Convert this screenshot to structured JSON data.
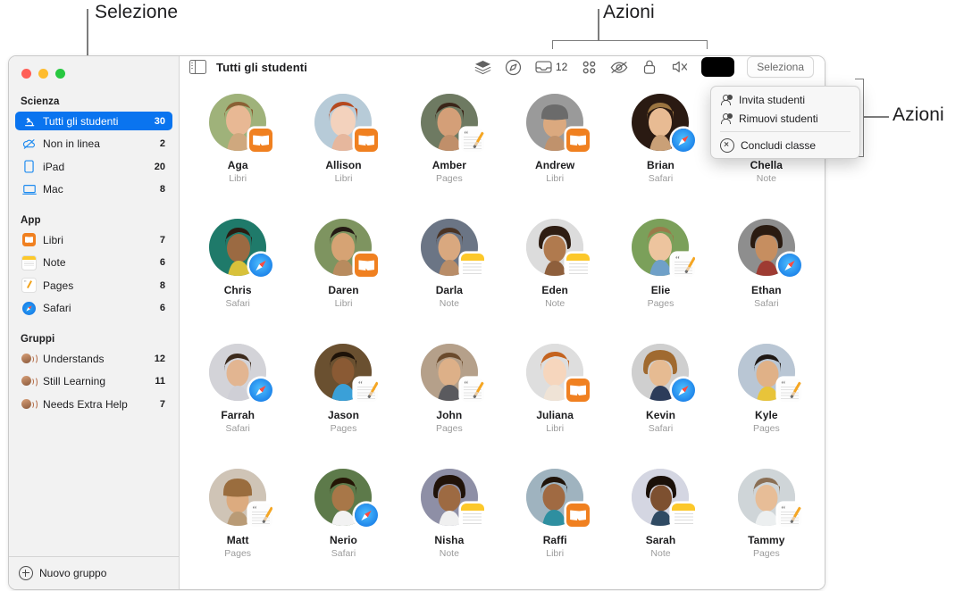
{
  "annotations": [
    {
      "id": "selezione",
      "label": "Selezione"
    },
    {
      "id": "azioni-top",
      "label": "Azioni"
    },
    {
      "id": "azioni-right",
      "label": "Azioni"
    }
  ],
  "window": {
    "traffic_lights": [
      "close",
      "minimize",
      "zoom"
    ]
  },
  "sidebar": {
    "sections": [
      {
        "title": "Scienza",
        "items": [
          {
            "label": "Tutti gli studenti",
            "count": "30",
            "icon": "microscope-icon",
            "selected": true
          },
          {
            "label": "Non in linea",
            "count": "2",
            "icon": "cloud-slash-icon",
            "selected": false
          },
          {
            "label": "iPad",
            "count": "20",
            "icon": "ipad-icon",
            "selected": false
          },
          {
            "label": "Mac",
            "count": "8",
            "icon": "mac-icon",
            "selected": false
          }
        ]
      },
      {
        "title": "App",
        "items": [
          {
            "label": "Libri",
            "count": "7",
            "icon": "books-app-icon",
            "selected": false
          },
          {
            "label": "Note",
            "count": "6",
            "icon": "notes-app-icon",
            "selected": false
          },
          {
            "label": "Pages",
            "count": "8",
            "icon": "pages-app-icon",
            "selected": false
          },
          {
            "label": "Safari",
            "count": "6",
            "icon": "safari-app-icon",
            "selected": false
          }
        ]
      },
      {
        "title": "Gruppi",
        "items": [
          {
            "label": "Understands",
            "count": "12",
            "icon": "group-icon",
            "selected": false
          },
          {
            "label": "Still Learning",
            "count": "11",
            "icon": "group-icon",
            "selected": false
          },
          {
            "label": "Needs Extra Help",
            "count": "7",
            "icon": "group-icon",
            "selected": false
          }
        ]
      }
    ],
    "footer": {
      "label": "Nuovo gruppo",
      "icon": "plus-circle-icon"
    }
  },
  "toolbar": {
    "sidebar_toggle_icon": "sidebar-toggle-icon",
    "title": "Tutti gli studenti",
    "actions": [
      {
        "icon": "layers-icon",
        "label": ""
      },
      {
        "icon": "navigate-icon",
        "label": ""
      },
      {
        "icon": "inbox-icon",
        "label": "12"
      },
      {
        "icon": "apps-grid-icon",
        "label": ""
      },
      {
        "icon": "eye-slash-icon",
        "label": ""
      },
      {
        "icon": "lock-icon",
        "label": ""
      },
      {
        "icon": "mute-icon",
        "label": ""
      }
    ],
    "active_button": {
      "icon": "screen-button-icon",
      "color": "#000000"
    },
    "select_button": {
      "label": "Seleziona"
    }
  },
  "menu": {
    "items": [
      {
        "label": "Invita studenti",
        "icon": "person-add-icon",
        "divider_after": false
      },
      {
        "label": "Rimuovi studenti",
        "icon": "person-remove-icon",
        "divider_after": true
      },
      {
        "label": "Concludi classe",
        "icon": "x-circle-icon",
        "divider_after": false
      }
    ]
  },
  "students": [
    {
      "name": "Aga",
      "app": "Libri",
      "badge": "libri",
      "skin": "#e8b894",
      "hair": "#8a6034",
      "bg": "#9fb27a"
    },
    {
      "name": "Allison",
      "app": "Libri",
      "badge": "libri",
      "skin": "#f3d2bd",
      "hair": "#b5491f",
      "bg": "#b7cbd8"
    },
    {
      "name": "Amber",
      "app": "Pages",
      "badge": "pages",
      "skin": "#d49f78",
      "hair": "#3a2418",
      "bg": "#6e7a62"
    },
    {
      "name": "Andrew",
      "app": "Libri",
      "badge": "libri",
      "skin": "#dba97f",
      "hair": "#2b2b2b",
      "bg": "#9a9a9a"
    },
    {
      "name": "Brian",
      "app": "Safari",
      "badge": "safari",
      "skin": "#e8bb93",
      "hair": "#9c7540",
      "bg": "#2a1a12"
    },
    {
      "name": "Chella",
      "app": "Note",
      "badge": "note",
      "skin": "#c98f64",
      "hair": "#3a2216",
      "bg": "#c0c0c0"
    },
    {
      "name": "Chris",
      "app": "Safari",
      "badge": "safari",
      "skin": "#9b6a42",
      "hair": "#2b1c12",
      "bg": "#1f7a6a"
    },
    {
      "name": "Daren",
      "app": "Libri",
      "badge": "libri",
      "skin": "#d6a374",
      "hair": "#241a14",
      "bg": "#7e9460"
    },
    {
      "name": "Darla",
      "app": "Note",
      "badge": "note",
      "skin": "#d9a87f",
      "hair": "#4a3324",
      "bg": "#6b7585"
    },
    {
      "name": "Eden",
      "app": "Note",
      "badge": "note",
      "skin": "#b07a4e",
      "hair": "#2e1d12",
      "bg": "#dcdcdc"
    },
    {
      "name": "Elie",
      "app": "Pages",
      "badge": "pages",
      "skin": "#edc49e",
      "hair": "#9b7a4a",
      "bg": "#7ba05a"
    },
    {
      "name": "Ethan",
      "app": "Safari",
      "badge": "safari",
      "skin": "#c68e60",
      "hair": "#2a1b11",
      "bg": "#8e8e8e"
    },
    {
      "name": "Farrah",
      "app": "Safari",
      "badge": "safari",
      "skin": "#e2b591",
      "hair": "#3c2a1c",
      "bg": "#d3d3d8"
    },
    {
      "name": "Jason",
      "app": "Pages",
      "badge": "pages",
      "skin": "#8a5a34",
      "hair": "#1d1208",
      "bg": "#6a5030"
    },
    {
      "name": "John",
      "app": "Pages",
      "badge": "pages",
      "skin": "#ddb088",
      "hair": "#6a4a2c",
      "bg": "#b5a08a"
    },
    {
      "name": "Juliana",
      "app": "Libri",
      "badge": "libri",
      "skin": "#f6d6bd",
      "hair": "#c4631f",
      "bg": "#dedede"
    },
    {
      "name": "Kevin",
      "app": "Safari",
      "badge": "safari",
      "skin": "#e6bb92",
      "hair": "#a06a30",
      "bg": "#cfcfcf"
    },
    {
      "name": "Kyle",
      "app": "Pages",
      "badge": "pages",
      "skin": "#e0b187",
      "hair": "#1e1713",
      "bg": "#b9c6d4"
    },
    {
      "name": "Matt",
      "app": "Pages",
      "badge": "pages",
      "skin": "#dcab7f",
      "hair": "#4a2f1c",
      "bg": "#cfc4b6"
    },
    {
      "name": "Nerio",
      "app": "Safari",
      "badge": "safari",
      "skin": "#a7apk",
      "hair": "#241505",
      "bg": "#5d7a4a"
    },
    {
      "name": "Nisha",
      "app": "Note",
      "badge": "note",
      "skin": "#9d6a42",
      "hair": "#201209",
      "bg": "#8e8fa6"
    },
    {
      "name": "Raffi",
      "app": "Libri",
      "badge": "libri",
      "skin": "#a06a42",
      "hair": "#1f1309",
      "bg": "#9fb3bf"
    },
    {
      "name": "Sarah",
      "app": "Note",
      "badge": "note",
      "skin": "#7d5030",
      "hair": "#1a1008",
      "bg": "#d4d6e2"
    },
    {
      "name": "Tammy",
      "app": "Pages",
      "badge": "pages",
      "skin": "#e7bd97",
      "hair": "#8a6f55",
      "bg": "#cfd5d8"
    }
  ]
}
